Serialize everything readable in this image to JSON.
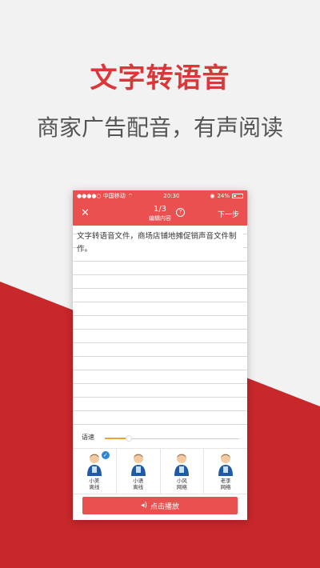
{
  "colors": {
    "accent": "#e9504f",
    "headline": "#d9373a",
    "background_red": "#c8282b",
    "slider_fill": "#f0a030",
    "check": "#2e86d6"
  },
  "headline": "文字转语音",
  "subline": "商家广告配音，有声阅读",
  "status_bar": {
    "carrier": "●●●●○ 中国移动",
    "time": "20:30",
    "battery": "24%"
  },
  "nav": {
    "close_icon": "close-icon",
    "page": "1/3",
    "subtitle": "编辑内容",
    "help": "?",
    "next": "下一步"
  },
  "editor": {
    "text": "文字转语音文件，商场店铺地摊促销声音文件制作。"
  },
  "speed": {
    "label": "语速",
    "value": 0.18
  },
  "voices": [
    {
      "name": "小美",
      "mode": "离线",
      "selected": true
    },
    {
      "name": "小语",
      "mode": "离线",
      "selected": false
    },
    {
      "name": "小风",
      "mode": "网络",
      "selected": false
    },
    {
      "name": "老李",
      "mode": "网络",
      "selected": false
    }
  ],
  "play_button": {
    "label": "点击播放",
    "icon": "sound-icon"
  }
}
